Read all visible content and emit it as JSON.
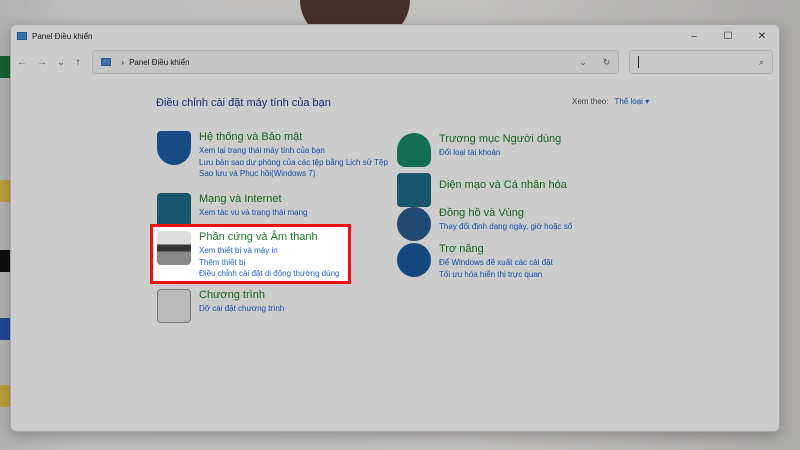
{
  "window": {
    "title": "Panel Điều khiển",
    "minimize": "–",
    "maximize": "☐",
    "close": "✕"
  },
  "nav": {
    "back": "←",
    "forward": "→",
    "recent": "⌄",
    "up": "↑",
    "breadcrumb_sep": "›",
    "breadcrumb": "Panel Điều khiển",
    "dropdown": "⌄",
    "refresh": "↻",
    "search_icon": "⌕",
    "search_placeholder": ""
  },
  "main": {
    "heading": "Điều chỉnh cài đặt máy tính của bạn",
    "view_by_label": "Xem theo:",
    "view_by_value": "Thể loại ▾"
  },
  "categories": [
    {
      "title": "Hệ thống và Bảo mật",
      "icon": "shield-icon",
      "links": [
        "Xem lại trạng thái máy tính của bạn",
        "Lưu bản sao dự phòng của các tệp bằng Lịch sử Tệp",
        "Sao lưu và Phục hồi(Windows 7)"
      ]
    },
    {
      "title": "Mạng và Internet",
      "icon": "network-icon",
      "links": [
        "Xem tác vụ và trạng thái mạng"
      ]
    },
    {
      "title": "Phần cứng và Âm thanh",
      "icon": "printer-icon",
      "links": [
        "Xem thiết bị và máy in",
        "Thêm thiết bị",
        "Điều chỉnh cài đặt di động thường dùng"
      ]
    },
    {
      "title": "Chương trình",
      "icon": "programs-icon",
      "links": [
        "Dỡ cài đặt chương trình"
      ]
    },
    {
      "title": "Trương mục Người dùng",
      "icon": "user-icon",
      "links": [
        "Đổi loại tài khoản"
      ]
    },
    {
      "title": "Diện mạo và Cá nhân hóa",
      "icon": "personalization-icon",
      "links": []
    },
    {
      "title": "Đồng hồ và Vùng",
      "icon": "clock-globe-icon",
      "links": [
        "Thay đổi định dạng ngày, giờ hoặc số"
      ]
    },
    {
      "title": "Trợ năng",
      "icon": "accessibility-icon",
      "links": [
        "Để Windows đề xuất các cài đặt",
        "Tối ưu hóa hiển thị trực quan"
      ]
    }
  ],
  "highlight_color": "#ee1111"
}
